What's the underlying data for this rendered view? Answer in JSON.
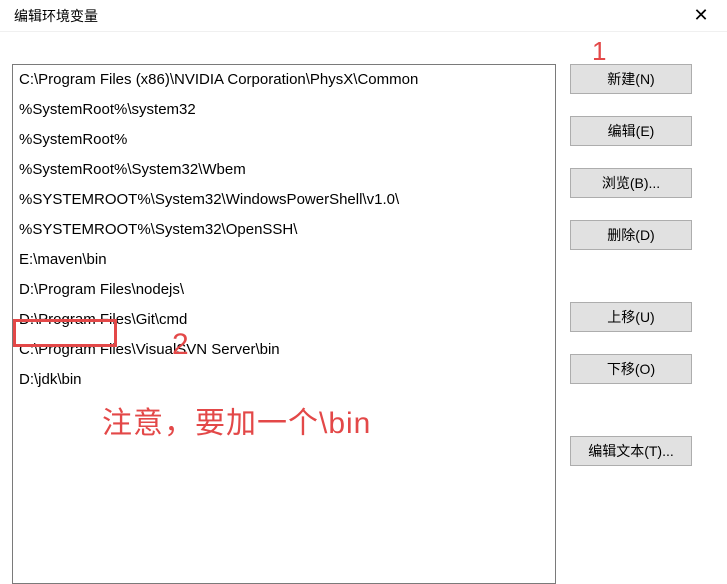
{
  "window": {
    "title": "编辑环境变量",
    "close": "✕"
  },
  "list": {
    "items": [
      "C:\\Program Files (x86)\\NVIDIA Corporation\\PhysX\\Common",
      "%SystemRoot%\\system32",
      "%SystemRoot%",
      "%SystemRoot%\\System32\\Wbem",
      "%SYSTEMROOT%\\System32\\WindowsPowerShell\\v1.0\\",
      "%SYSTEMROOT%\\System32\\OpenSSH\\",
      "E:\\maven\\bin",
      "D:\\Program Files\\nodejs\\",
      "D:\\Program Files\\Git\\cmd",
      "C:\\Program Files\\VisualSVN Server\\bin",
      "D:\\jdk\\bin"
    ]
  },
  "buttons": {
    "new": "新建(N)",
    "edit": "编辑(E)",
    "browse": "浏览(B)...",
    "delete": "删除(D)",
    "moveUp": "上移(U)",
    "moveDown": "下移(O)",
    "editText": "编辑文本(T)..."
  },
  "annotations": {
    "one": "1",
    "two": "2",
    "note": "注意，要加一个\\bin"
  }
}
